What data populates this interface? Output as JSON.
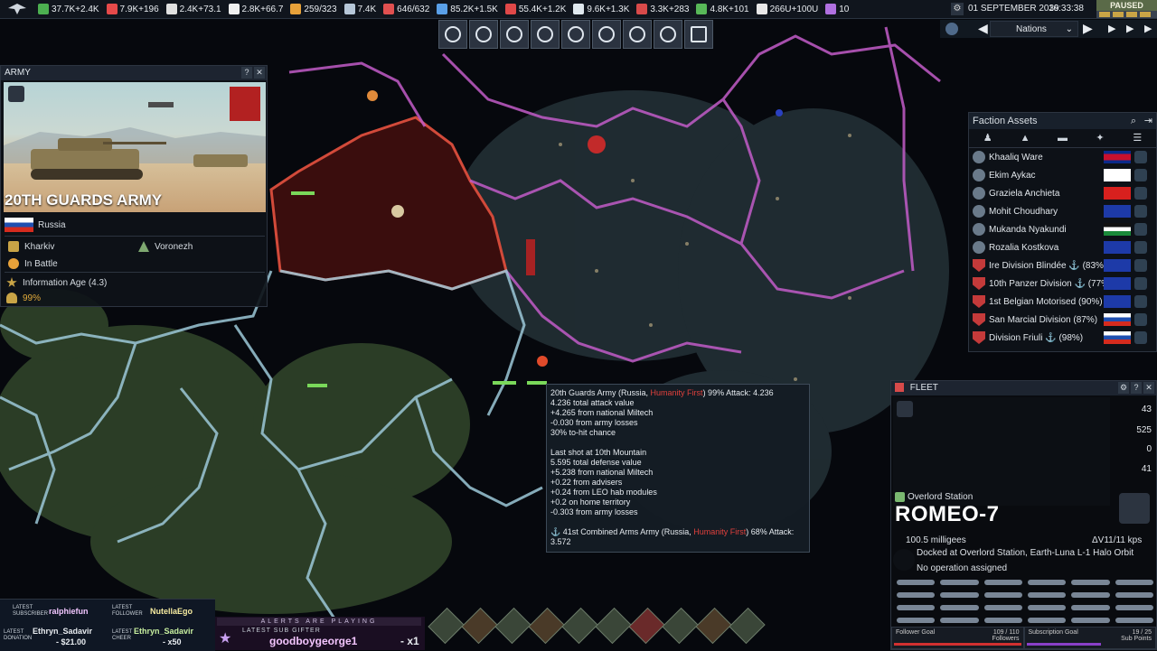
{
  "top_bar": {
    "resources": [
      {
        "icon": "influence-icon",
        "value": "37.7K+2.4K",
        "color": "#4caf50"
      },
      {
        "icon": "ops-icon",
        "value": "7.9K+196",
        "color": "#e64a4a"
      },
      {
        "icon": "boost-icon",
        "value": "2.4K+73.1",
        "color": "#e0e0e0"
      },
      {
        "icon": "mission-control-icon",
        "value": "2.8K+66.7",
        "color": "#f0f0f0"
      },
      {
        "icon": "research-icon",
        "value": "259/323",
        "color": "#e8a23a"
      },
      {
        "icon": "water-icon",
        "value": "7.4K",
        "color": "#b6c7d8"
      },
      {
        "icon": "volatiles-icon",
        "value": "646/632",
        "color": "#e05050"
      },
      {
        "icon": "metals-icon",
        "value": "85.2K+1.5K",
        "color": "#5aa0e8"
      },
      {
        "icon": "noble-metals-icon",
        "value": "55.4K+1.2K",
        "color": "#e04848"
      },
      {
        "icon": "fissiles-icon",
        "value": "9.6K+1.3K",
        "color": "#dfe8ee"
      },
      {
        "icon": "antimatter-icon",
        "value": "3.3K+283",
        "color": "#d84a4a"
      },
      {
        "icon": "exotics-icon",
        "value": "4.8K+101",
        "color": "#58b858"
      },
      {
        "icon": "control-points-icon",
        "value": "266U+100U",
        "color": "#e8e8e8"
      },
      {
        "icon": "flag-icon",
        "value": "10",
        "color": "#b070e0"
      }
    ],
    "date": "01 SEPTEMBER 2039",
    "time": "16:33:38",
    "paused": "PAUSED"
  },
  "nations_selector": {
    "label": "Nations"
  },
  "army_panel": {
    "header": "ARMY",
    "title": "20TH GUARDS ARMY",
    "nation": "Russia",
    "home_region": "Kharkiv",
    "location": "Voronezh",
    "status": "In Battle",
    "tech_age": "Information Age (4.3)",
    "strength": "99%"
  },
  "faction_assets": {
    "header": "Faction Assets",
    "items": [
      {
        "name": "Khaaliq Ware",
        "kind": "councilor",
        "flag": "cambodia"
      },
      {
        "name": "Ekim Aykac",
        "kind": "councilor",
        "flag": "korea"
      },
      {
        "name": "Graziela Anchieta",
        "kind": "councilor",
        "flag": "vietnam"
      },
      {
        "name": "Mohit Choudhary",
        "kind": "councilor",
        "flag": "eu"
      },
      {
        "name": "Mukanda Nyakundi",
        "kind": "councilor",
        "flag": "jordan"
      },
      {
        "name": "Rozalia Kostkova",
        "kind": "councilor",
        "flag": "eu"
      },
      {
        "name": "Ire Division Blindée ⚓ (83%)",
        "kind": "army",
        "flag": "eu"
      },
      {
        "name": "10th Panzer Division ⚓ (77%)",
        "kind": "army",
        "flag": "eu"
      },
      {
        "name": "1st Belgian Motorised (90%)",
        "kind": "army",
        "flag": "eu"
      },
      {
        "name": "San Marcial Division (87%)",
        "kind": "army",
        "flag": "russia"
      },
      {
        "name": "Division Friuli ⚓ (98%)",
        "kind": "army",
        "flag": "russia"
      }
    ]
  },
  "fleet_panel": {
    "header": "FLEET",
    "stats": [
      "43",
      "525",
      "0",
      "41"
    ],
    "station_type": "Overlord Station",
    "name": "ROMEO-7",
    "mass": "100.5 milligees",
    "delta_v": "ΔV11/11 kps",
    "docked": "Docked at Overlord Station, Earth-Luna L-1 Halo Orbit",
    "operation": "No operation assigned",
    "goal_follower": "Follower Goal",
    "goal_follower_count": "109 / 110",
    "goal_follower_unit": "Followers",
    "goal_sub": "Subscription Goal",
    "goal_sub_count": "19 / 25",
    "goal_sub_unit": "Sub Points"
  },
  "tooltip": {
    "line1_a": "20th Guards Army (Russia, ",
    "line1_red": "Humanity First",
    "line1_b": ") 99% Attack: 4.236",
    "lines": [
      "4.236 total attack value",
      " +4.265 from national Miltech",
      " -0.030 from army losses",
      "30% to-hit chance",
      "",
      "Last shot at 10th Mountain",
      "5.595 total defense value",
      " +5.238 from national Miltech",
      " +0.22 from advisers",
      " +0.24 from LEO hab modules",
      " +0.2 on home territory",
      " -0.303 from army losses"
    ],
    "enemy_a": "⚓ 41st Combined Arms Army (Russia, ",
    "enemy_red": "Humanity First",
    "enemy_b": ") 68% Attack:",
    "enemy_c": "3.572"
  },
  "stream_overlay": {
    "latest_subscriber_label": "LATEST SUBSCRIBER",
    "latest_subscriber": "ralphiefun",
    "latest_follower_label": "LATEST FOLLOWER",
    "latest_follower": "NutellaEgo",
    "latest_donation_label": "LATEST DONATION",
    "latest_donation_name": "Ethryn_Sadavir",
    "latest_donation_amount": "- $21.00",
    "latest_cheer_label": "LATEST CHEER",
    "latest_cheer_name": "Ethryn_Sadavir",
    "latest_cheer_amount": "- x50",
    "ticker": "ALERTS ARE PLAYING",
    "gifter_label": "LATEST SUB GIFTER",
    "gifter_name": "goodboygeorge1",
    "gifter_amount": "- x1"
  }
}
